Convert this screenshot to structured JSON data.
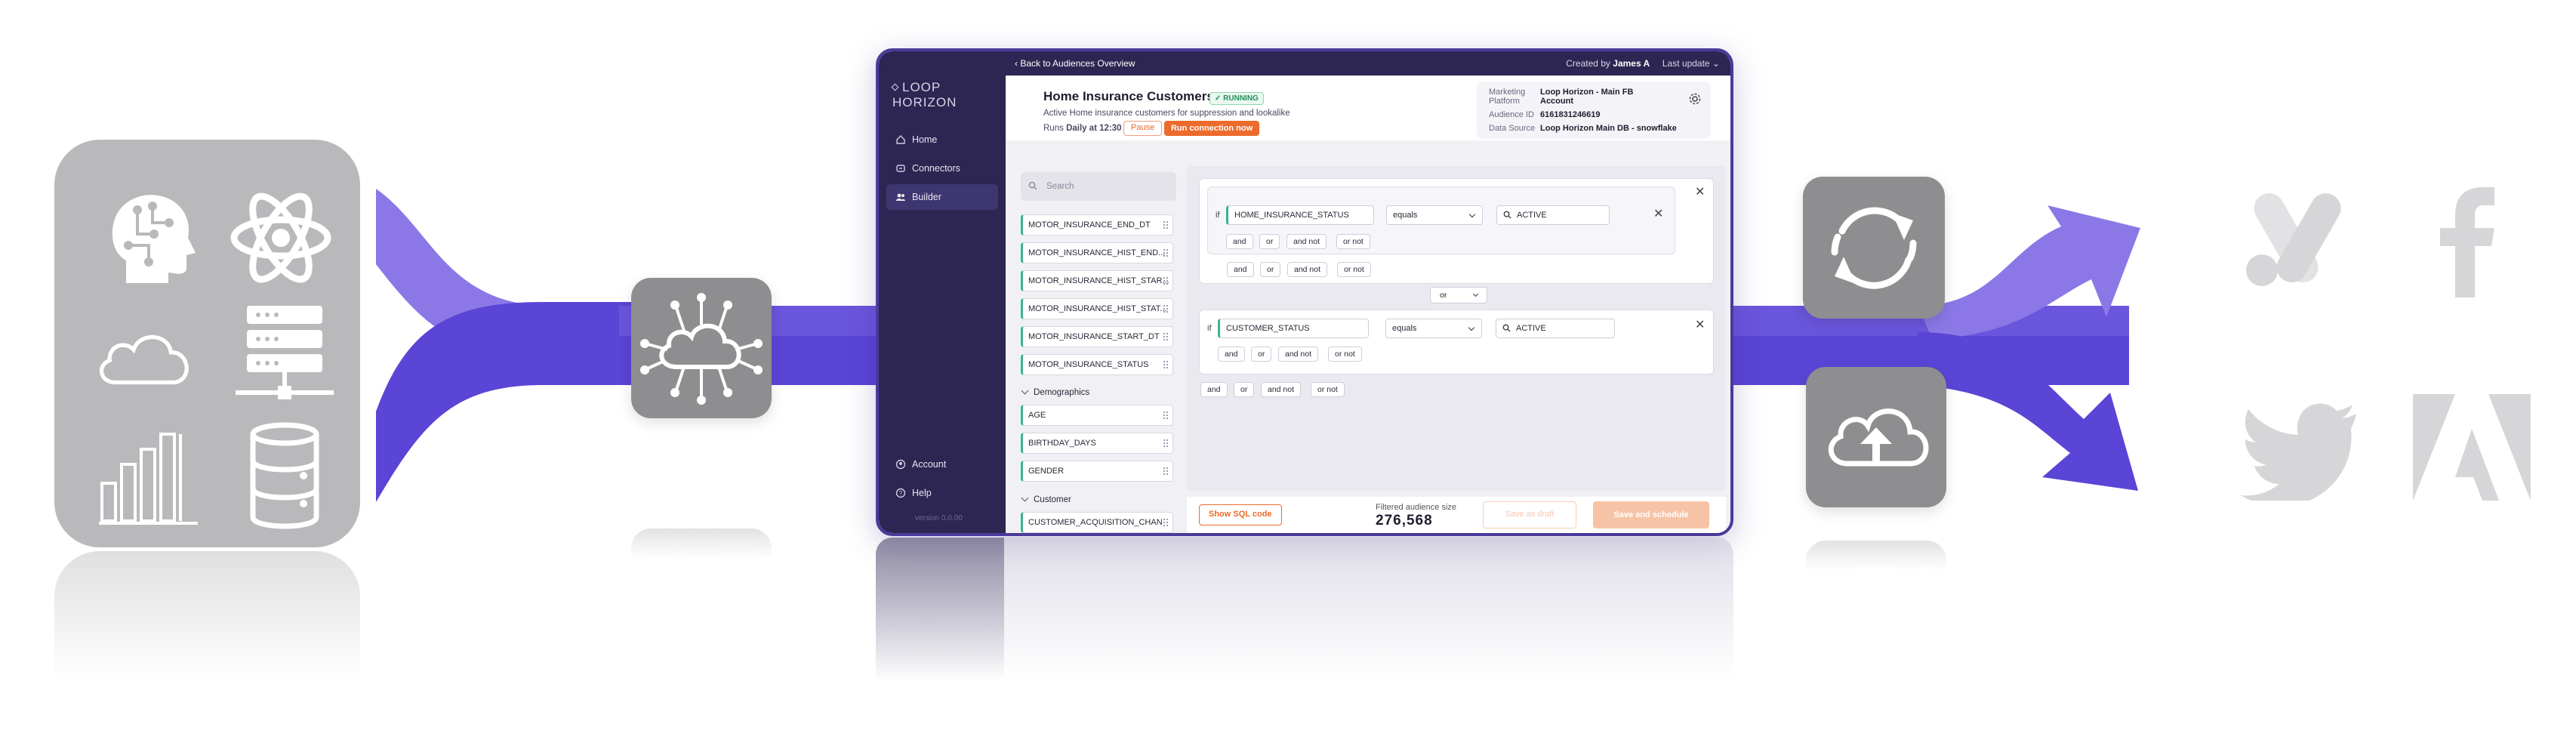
{
  "app": {
    "logo": "LOOP HORIZON",
    "nav": [
      {
        "label": "Home",
        "icon": "home-icon"
      },
      {
        "label": "Connectors",
        "icon": "connectors-icon"
      },
      {
        "label": "Builder",
        "icon": "builder-icon",
        "active": true
      }
    ],
    "nav_bottom": [
      {
        "label": "Account",
        "icon": "account-icon"
      },
      {
        "label": "Help",
        "icon": "help-icon"
      }
    ],
    "version": "version 0.0.00"
  },
  "topbar": {
    "back_label": "Back to Audiences Overview",
    "created_by_label": "Created by",
    "created_by": "James A",
    "last_update": "Last update"
  },
  "audience": {
    "title": "Home Insurance Customers",
    "status": "RUNNING",
    "description": "Active Home insurance customers for suppression and lookalike",
    "runs_label": "Runs",
    "runs_value": "Daily at 12:30",
    "pause_label": "Pause",
    "run_now_label": "Run connection now"
  },
  "meta": {
    "platform_key": "Marketing Platform",
    "platform_value": "Loop Horizon - Main FB Account",
    "audience_id_key": "Audience ID",
    "audience_id_value": "6161831246619",
    "data_source_key": "Data Source",
    "data_source_value": "Loop Horizon Main DB - snowflake"
  },
  "search": {
    "placeholder": "Search"
  },
  "attributes": [
    "MOTOR_INSURANCE_END_DT",
    "MOTOR_INSURANCE_HIST_END...",
    "MOTOR_INSURANCE_HIST_STAR...",
    "MOTOR_INSURANCE_HIST_STAT...",
    "MOTOR_INSURANCE_START_DT",
    "MOTOR_INSURANCE_STATUS"
  ],
  "groups": [
    {
      "name": "Demographics",
      "items": [
        "AGE",
        "BIRTHDAY_DAYS",
        "GENDER"
      ]
    },
    {
      "name": "Customer",
      "items": [
        "CUSTOMER_ACQUISITION_CHAN"
      ]
    }
  ],
  "conditions": [
    {
      "if_label": "if",
      "field": "HOME_INSURANCE_STATUS",
      "operator": "equals",
      "value": "ACTIVE",
      "pills": [
        "and",
        "or",
        "and not",
        "or not"
      ],
      "outer_pills": [
        "and",
        "or",
        "and not",
        "or not"
      ]
    },
    {
      "if_label": "if",
      "field": "CUSTOMER_STATUS",
      "operator": "equals",
      "value": "ACTIVE",
      "pills": [
        "and",
        "or",
        "and not",
        "or not"
      ],
      "outer_pills": [
        "and",
        "or",
        "and not",
        "or not"
      ]
    }
  ],
  "joiner": "or",
  "footer": {
    "sql_label": "Show SQL code",
    "size_label": "Filtered audience size",
    "size_value": "276,568",
    "draft_label": "Save as draft",
    "schedule_label": "Save and schedule"
  },
  "colors": {
    "flow_primary": "#5a45d6",
    "flow_light": "#8b78e6",
    "sidebar": "#2d2652",
    "accent_orange": "#ec6a2c",
    "running_green": "#1f8f5a",
    "tile_gray": "#8e8e90",
    "panel_gray": "#b9b9bc"
  },
  "sources": [
    "ai-head-icon",
    "atom-icon",
    "cloud-icon",
    "server-rack-icon",
    "bar-chart-icon",
    "database-icon"
  ],
  "pipeline_tiles": [
    "cloud-network-icon",
    "sync-icon",
    "cloud-upload-icon"
  ],
  "destinations": [
    "google-ads-logo",
    "facebook-logo",
    "twitter-logo",
    "adobe-logo"
  ]
}
